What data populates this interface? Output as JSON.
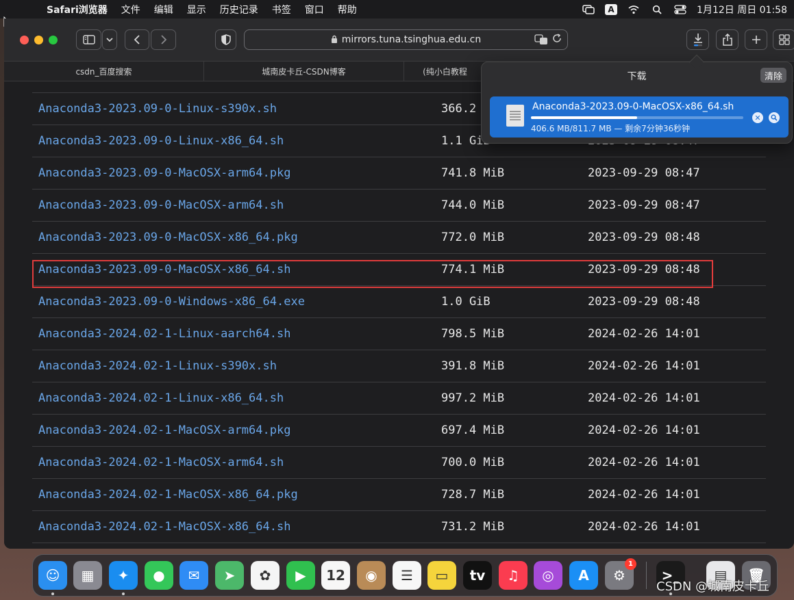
{
  "menubar": {
    "apple": "",
    "items": [
      "Safari浏览器",
      "文件",
      "编辑",
      "显示",
      "历史记录",
      "书签",
      "窗口",
      "帮助"
    ],
    "status_icons": [
      "screen-mirroring-icon",
      "input-source-icon",
      "wifi-icon",
      "search-icon",
      "control-center-icon"
    ],
    "input_source_label": "A",
    "clock": "1月12日 周日  01:58"
  },
  "toolbar": {
    "address": "mirrors.tuna.tsinghua.edu.cn"
  },
  "tabs": [
    {
      "label": "csdn_百度搜索"
    },
    {
      "label": "城南皮卡丘-CSDN博客"
    },
    {
      "label": "(纯小白教程"
    }
  ],
  "files": [
    {
      "name": "Anaconda3-2023.09-0-Linux-s390x.sh",
      "size": "366.2",
      "date": ""
    },
    {
      "name": "Anaconda3-2023.09-0-Linux-x86_64.sh",
      "size": "1.1 GiB",
      "date": "2023-09-29 08:47"
    },
    {
      "name": "Anaconda3-2023.09-0-MacOSX-arm64.pkg",
      "size": "741.8 MiB",
      "date": "2023-09-29 08:47"
    },
    {
      "name": "Anaconda3-2023.09-0-MacOSX-arm64.sh",
      "size": "744.0 MiB",
      "date": "2023-09-29 08:47"
    },
    {
      "name": "Anaconda3-2023.09-0-MacOSX-x86_64.pkg",
      "size": "772.0 MiB",
      "date": "2023-09-29 08:48"
    },
    {
      "name": "Anaconda3-2023.09-0-MacOSX-x86_64.sh",
      "size": "774.1 MiB",
      "date": "2023-09-29 08:48"
    },
    {
      "name": "Anaconda3-2023.09-0-Windows-x86_64.exe",
      "size": "1.0 GiB",
      "date": "2023-09-29 08:48"
    },
    {
      "name": "Anaconda3-2024.02-1-Linux-aarch64.sh",
      "size": "798.5 MiB",
      "date": "2024-02-26 14:01"
    },
    {
      "name": "Anaconda3-2024.02-1-Linux-s390x.sh",
      "size": "391.8 MiB",
      "date": "2024-02-26 14:01"
    },
    {
      "name": "Anaconda3-2024.02-1-Linux-x86_64.sh",
      "size": "997.2 MiB",
      "date": "2024-02-26 14:01"
    },
    {
      "name": "Anaconda3-2024.02-1-MacOSX-arm64.pkg",
      "size": "697.4 MiB",
      "date": "2024-02-26 14:01"
    },
    {
      "name": "Anaconda3-2024.02-1-MacOSX-arm64.sh",
      "size": "700.0 MiB",
      "date": "2024-02-26 14:01"
    },
    {
      "name": "Anaconda3-2024.02-1-MacOSX-x86_64.pkg",
      "size": "728.7 MiB",
      "date": "2024-02-26 14:01"
    },
    {
      "name": "Anaconda3-2024.02-1-MacOSX-x86_64.sh",
      "size": "731.2 MiB",
      "date": "2024-02-26 14:01"
    }
  ],
  "downloads": {
    "title": "下载",
    "clear_label": "清除",
    "item": {
      "filename": "Anaconda3-2023.09-0-MacOSX-x86_64.sh",
      "status": "406.6 MB/811.7 MB — 剩余7分钟36秒钟",
      "progress": 0.5
    }
  },
  "dock": {
    "apps": [
      {
        "name": "finder",
        "icon": "finder-icon",
        "color": "#2a8ff0",
        "glyph": "☺",
        "running": true
      },
      {
        "name": "launchpad",
        "icon": "launchpad-icon",
        "color": "#8a8a92",
        "glyph": "▦",
        "running": false
      },
      {
        "name": "safari",
        "icon": "safari-icon",
        "color": "#1a8df0",
        "glyph": "✦",
        "running": true
      },
      {
        "name": "messages",
        "icon": "messages-icon",
        "color": "#34c759",
        "glyph": "●",
        "running": false
      },
      {
        "name": "mail",
        "icon": "mail-icon",
        "color": "#2f8cf5",
        "glyph": "✉",
        "running": false
      },
      {
        "name": "maps",
        "icon": "maps-icon",
        "color": "#4cb86a",
        "glyph": "➤",
        "running": false
      },
      {
        "name": "photos",
        "icon": "photos-icon",
        "color": "#f5f5f5",
        "glyph": "✿",
        "running": false
      },
      {
        "name": "facetime",
        "icon": "facetime-icon",
        "color": "#30c04f",
        "glyph": "▶",
        "running": false
      },
      {
        "name": "calendar",
        "icon": "calendar-icon",
        "color": "#f7f7f7",
        "glyph": "12",
        "running": false
      },
      {
        "name": "contacts",
        "icon": "contacts-icon",
        "color": "#b98b57",
        "glyph": "◉",
        "running": false
      },
      {
        "name": "reminders",
        "icon": "reminders-icon",
        "color": "#f7f7f7",
        "glyph": "☰",
        "running": false
      },
      {
        "name": "notes",
        "icon": "notes-icon",
        "color": "#f5d43c",
        "glyph": "▭",
        "running": false
      },
      {
        "name": "apple-tv",
        "icon": "apple-tv-icon",
        "color": "#111111",
        "glyph": "tv",
        "running": false
      },
      {
        "name": "music",
        "icon": "music-icon",
        "color": "#fb3c50",
        "glyph": "♫",
        "running": false
      },
      {
        "name": "podcasts",
        "icon": "podcasts-icon",
        "color": "#a64bd9",
        "glyph": "◎",
        "running": false
      },
      {
        "name": "app-store",
        "icon": "app-store-icon",
        "color": "#1b8ff5",
        "glyph": "A",
        "running": false
      },
      {
        "name": "system-settings",
        "icon": "settings-icon",
        "color": "#7a7a80",
        "glyph": "⚙",
        "running": false,
        "badge": "1"
      },
      {
        "name": "terminal",
        "icon": "terminal-icon",
        "color": "#1a1a1a",
        "glyph": ">_",
        "running": true
      },
      {
        "name": "preview",
        "icon": "preview-icon",
        "color": "#e8e8ea",
        "glyph": "▤",
        "running": false
      },
      {
        "name": "trash",
        "icon": "trash-icon",
        "color": "#6a6a70",
        "glyph": "🗑",
        "running": false
      }
    ]
  },
  "watermark": "CSDN @城南皮卡丘"
}
